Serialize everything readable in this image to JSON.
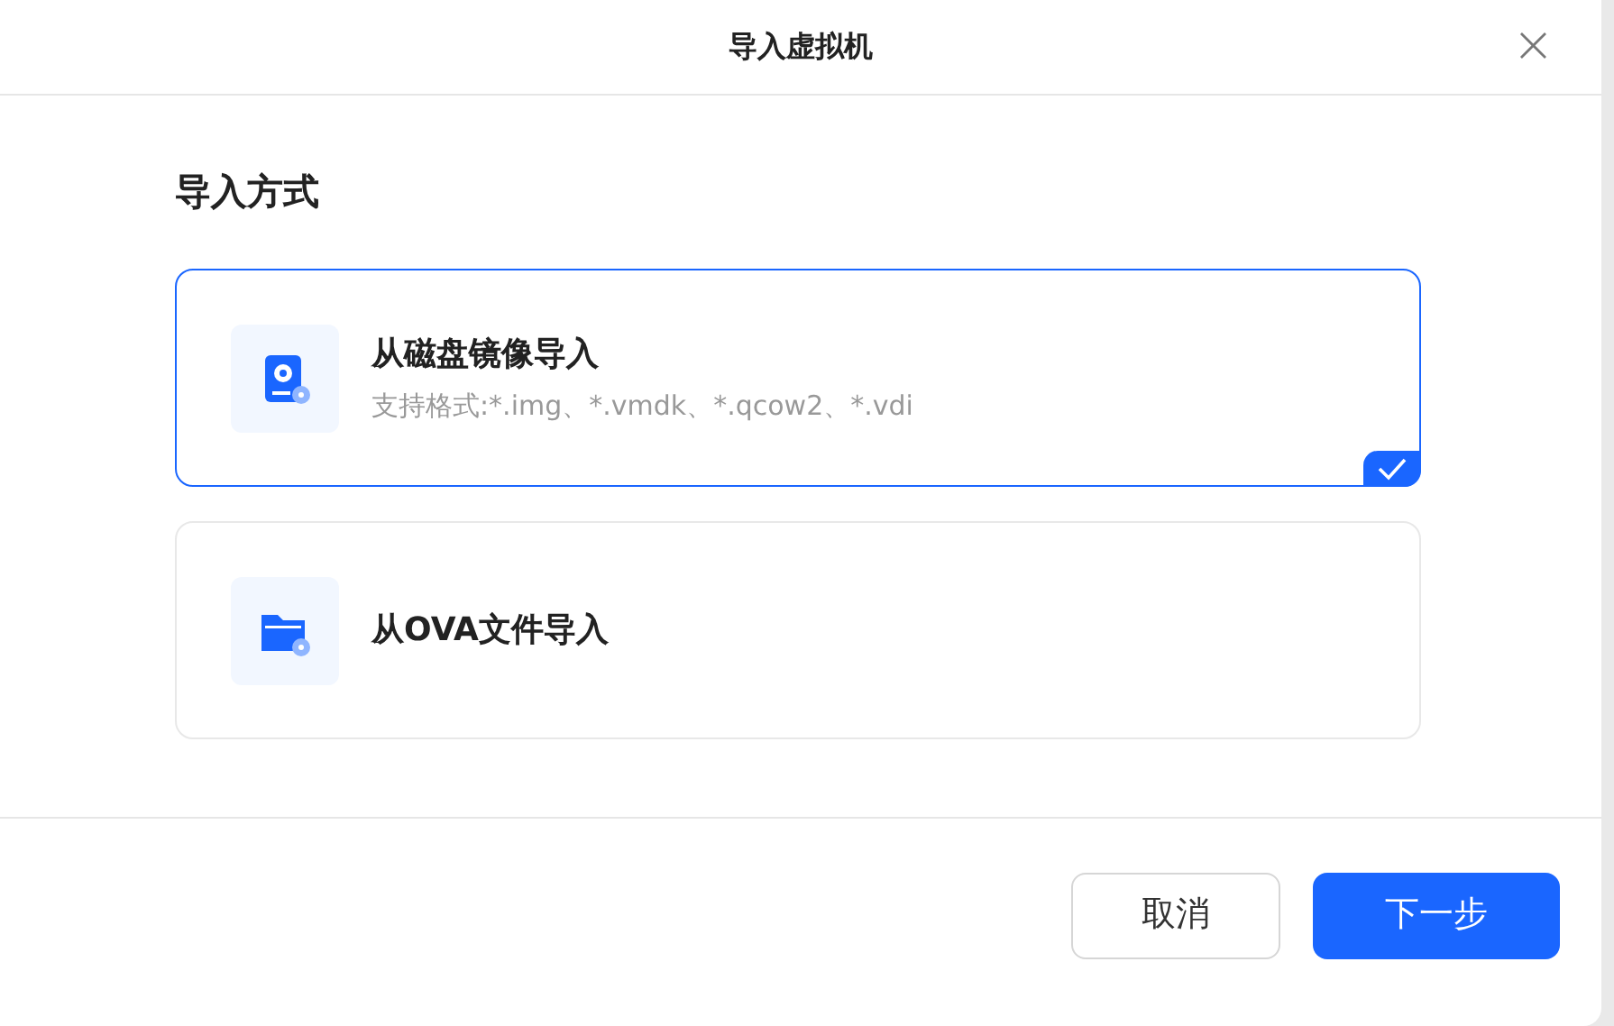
{
  "dialog": {
    "title": "导入虚拟机",
    "close": "×"
  },
  "section_title": "导入方式",
  "options": [
    {
      "kind": "disk",
      "title": "从磁盘镜像导入",
      "subtitle": "支持格式:*.img、*.vmdk、*.qcow2、*.vdi",
      "selected": true
    },
    {
      "kind": "folder",
      "title": "从OVA文件导入",
      "selected": false
    }
  ],
  "buttons": [
    {
      "kind": "secondary",
      "label": "取消"
    },
    {
      "kind": "primary",
      "label": "下一步"
    }
  ]
}
